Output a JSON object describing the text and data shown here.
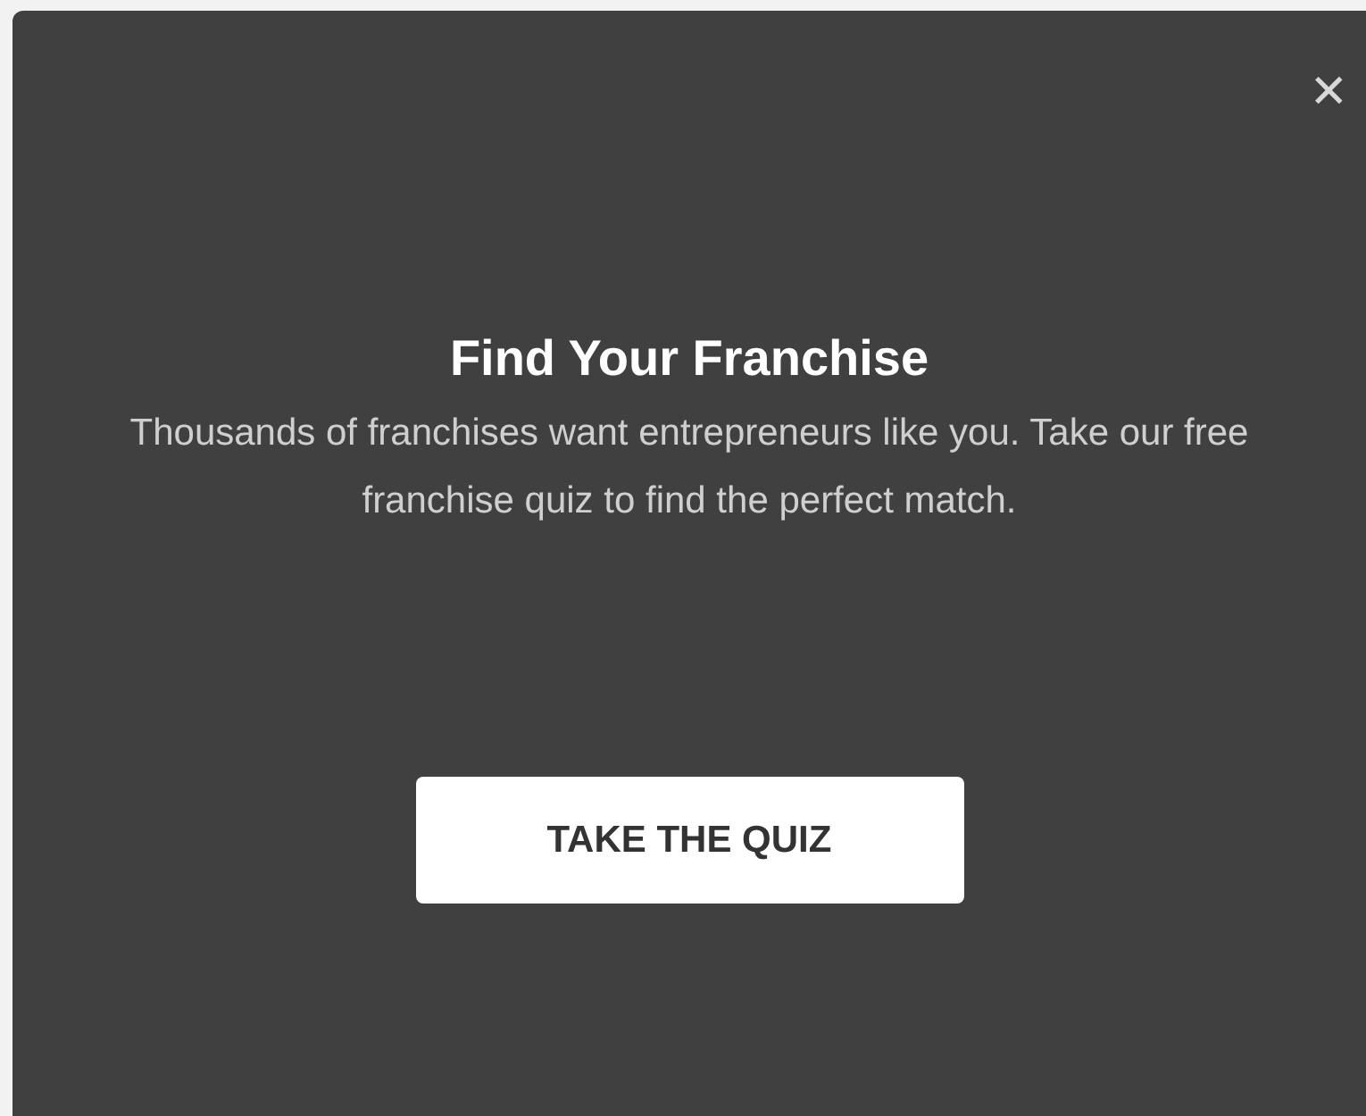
{
  "modal": {
    "close": "✕",
    "title": "Find Your Franchise",
    "text": "Thousands of franchises want entrepreneurs like you. Take our free franchise quiz to find the perfect match.",
    "button": "TAKE THE QUIZ"
  }
}
